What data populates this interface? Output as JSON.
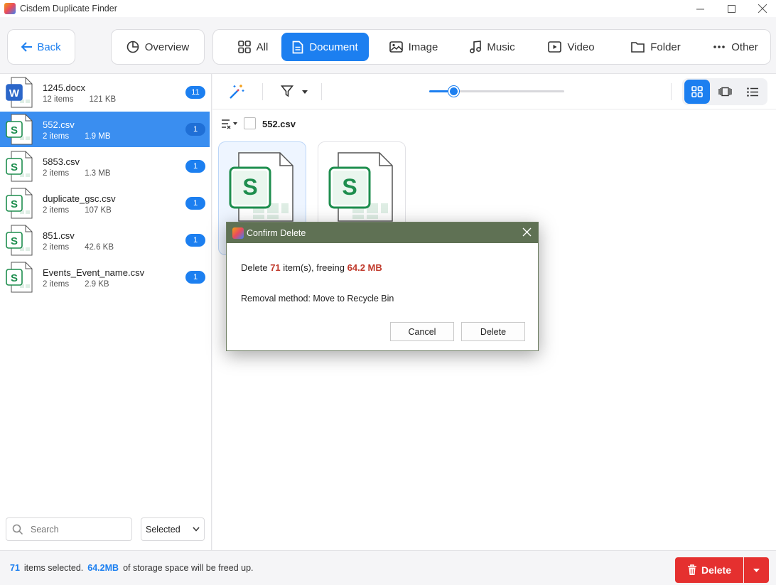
{
  "window": {
    "title": "Cisdem Duplicate Finder"
  },
  "toolbar": {
    "back_label": "Back",
    "overview_label": "Overview",
    "tabs": [
      {
        "label": "All"
      },
      {
        "label": "Document"
      },
      {
        "label": "Image"
      },
      {
        "label": "Music"
      },
      {
        "label": "Video"
      },
      {
        "label": "Folder"
      },
      {
        "label": "Other"
      }
    ],
    "active_tab": "Document"
  },
  "sidebar": {
    "files": [
      {
        "name": "1245.docx",
        "items": "12 items",
        "size": "121 KB",
        "count": "11",
        "type": "word"
      },
      {
        "name": "552.csv",
        "items": "2 items",
        "size": "1.9 MB",
        "count": "1",
        "type": "sheet"
      },
      {
        "name": "5853.csv",
        "items": "2 items",
        "size": "1.3 MB",
        "count": "1",
        "type": "sheet"
      },
      {
        "name": "duplicate_gsc.csv",
        "items": "2 items",
        "size": "107 KB",
        "count": "1",
        "type": "sheet"
      },
      {
        "name": "851.csv",
        "items": "2 items",
        "size": "42.6 KB",
        "count": "1",
        "type": "sheet"
      },
      {
        "name": "Events_Event_name.csv",
        "items": "2 items",
        "size": "2.9 KB",
        "count": "1",
        "type": "sheet"
      }
    ],
    "selected_index": 1,
    "search_placeholder": "Search",
    "filter_value": "Selected"
  },
  "content": {
    "group_name": "552.csv",
    "zoom_fraction": 0.18,
    "view_mode": "grid"
  },
  "dialog": {
    "title": "Confirm Delete",
    "msg_prefix": "Delete",
    "count": "71",
    "msg_middle": "item(s), freeing",
    "size": "64.2 MB",
    "removal": "Removal method: Move to Recycle Bin",
    "cancel_label": "Cancel",
    "delete_label": "Delete"
  },
  "status": {
    "count": "71",
    "count_suffix": "items selected.",
    "size": "64.2MB",
    "size_suffix": "of storage space will be freed up.",
    "delete_label": "Delete"
  },
  "colors": {
    "accent": "#1c7ff0",
    "danger": "#e5302f",
    "dialog_title": "#5f7154",
    "sheet_green": "#1e8e4e",
    "word_blue": "#2b66c9"
  }
}
